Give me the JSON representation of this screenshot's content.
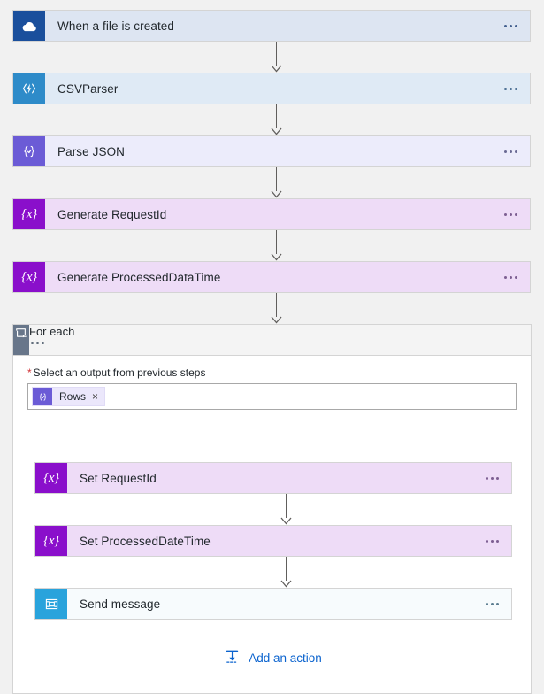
{
  "flow": {
    "nodes": [
      {
        "id": "trigger",
        "title": "When a file is created",
        "icon": "onedrive-cloud-icon",
        "theme": "onedrive",
        "menu": "more-commands"
      },
      {
        "id": "csvparser",
        "title": "CSVParser",
        "icon": "azure-function-icon",
        "theme": "function",
        "menu": "more-commands"
      },
      {
        "id": "parsejson",
        "title": "Parse JSON",
        "icon": "parse-json-icon",
        "theme": "parsejson",
        "menu": "more-commands"
      },
      {
        "id": "genreq",
        "title": "Generate RequestId",
        "icon": "variable-icon",
        "theme": "variable",
        "menu": "more-commands"
      },
      {
        "id": "genproc",
        "title": "Generate ProcessedDataTime",
        "icon": "variable-icon",
        "theme": "variable",
        "menu": "more-commands"
      }
    ],
    "foreach": {
      "title": "For each",
      "icon": "loop-icon",
      "field": {
        "required_marker": "*",
        "label": "Select an output from previous steps",
        "token": {
          "label": "Rows",
          "icon": "parse-json-icon",
          "remove": "×"
        },
        "placeholder": "Select an output from previous steps"
      },
      "nodes": [
        {
          "id": "setreq",
          "title": "Set RequestId",
          "icon": "variable-icon",
          "theme": "variable",
          "menu": "more-commands"
        },
        {
          "id": "setproc",
          "title": "Set ProcessedDateTime",
          "icon": "variable-icon",
          "theme": "variable",
          "menu": "more-commands"
        },
        {
          "id": "sendmsg",
          "title": "Send message",
          "icon": "service-bus-icon",
          "theme": "servicebus",
          "menu": "more-commands"
        }
      ],
      "add_action": {
        "label": "Add an action",
        "icon": "insert-action-icon"
      }
    },
    "colors": {
      "canvas_background": "#f1f1f1",
      "onedrive_blue": "#1a4f9c",
      "function_blue": "#2e8bc9",
      "parse_json_purple": "#6b5bd6",
      "variable_purple": "#8a0fcb",
      "foreach_gray": "#68768a",
      "service_bus_blue": "#29a3dc",
      "link_blue": "#0b63ce",
      "required_red": "#d13438",
      "connector_gray": "#605e5c"
    }
  }
}
